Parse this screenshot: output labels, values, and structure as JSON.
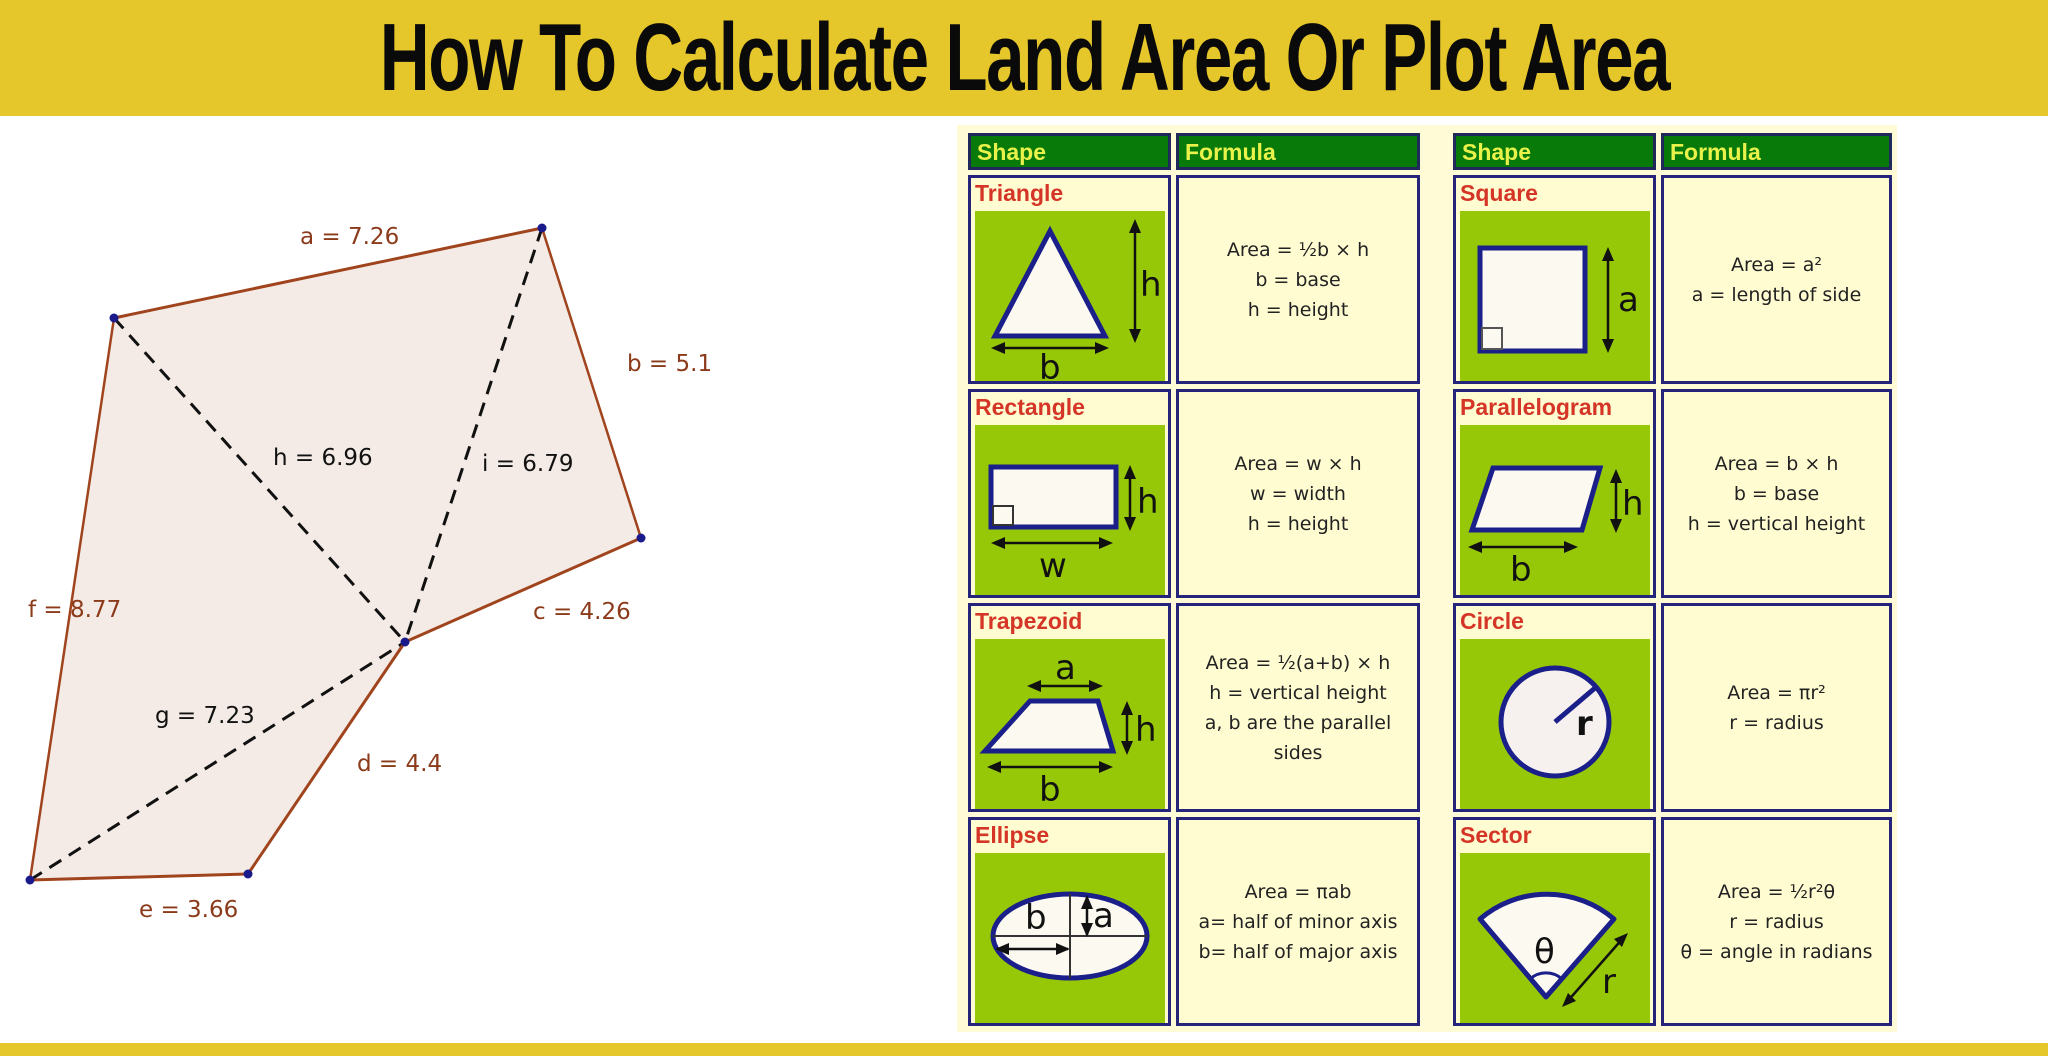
{
  "page": {
    "title": "How To Calculate Land Area Or Plot Area",
    "colors": {
      "banner": "#e5c62b",
      "title_text": "#0a0a0a",
      "polygon_edge": "#a0441e",
      "polygon_fill": "#f4ebe6",
      "vertex": "#1a1a8a",
      "table_header_bg": "#087a0a",
      "table_header_text": "#e9f24a",
      "cell_bg": "#fffcd2",
      "cell_border": "#24247a",
      "shape_name": "#d43526",
      "figure_bg": "#97c808",
      "figure_stroke": "#1a1f8a"
    }
  },
  "polygon": {
    "edges": [
      {
        "name": "a",
        "label": "a = 7.26",
        "length": 7.26
      },
      {
        "name": "b",
        "label": "b = 5.1",
        "length": 5.1
      },
      {
        "name": "c",
        "label": "c = 4.26",
        "length": 4.26
      },
      {
        "name": "d",
        "label": "d = 4.4",
        "length": 4.4
      },
      {
        "name": "e",
        "label": "e = 3.66",
        "length": 3.66
      },
      {
        "name": "f",
        "label": "f = 8.77",
        "length": 8.77
      }
    ],
    "diagonals": [
      {
        "name": "g",
        "label": "g = 7.23",
        "length": 7.23
      },
      {
        "name": "h",
        "label": "h = 6.96",
        "length": 6.96
      },
      {
        "name": "i",
        "label": "i = 6.79",
        "length": 6.79
      }
    ]
  },
  "tables": {
    "headers": {
      "shape": "Shape",
      "formula": "Formula"
    },
    "left": [
      {
        "shape": "Triangle",
        "icon": "triangle-icon",
        "figure_labels": {
          "base": "b",
          "height": "h"
        },
        "formula": [
          "Area = ½b × h",
          "b = base",
          "h = height"
        ]
      },
      {
        "shape": "Rectangle",
        "icon": "rectangle-icon",
        "figure_labels": {
          "width": "w",
          "height": "h"
        },
        "formula": [
          "Area = w × h",
          "w = width",
          "h = height"
        ]
      },
      {
        "shape": "Trapezoid",
        "icon": "trapezoid-icon",
        "figure_labels": {
          "top": "a",
          "bottom": "b",
          "height": "h"
        },
        "formula": [
          "Area = ½(a+b) × h",
          "h = vertical height",
          "a, b are the parallel",
          "sides"
        ]
      },
      {
        "shape": "Ellipse",
        "icon": "ellipse-icon",
        "figure_labels": {
          "major": "b",
          "minor": "a"
        },
        "formula": [
          "Area = πab",
          "a= half of minor axis",
          "b= half of major axis"
        ]
      }
    ],
    "right": [
      {
        "shape": "Square",
        "icon": "square-icon",
        "figure_labels": {
          "side": "a"
        },
        "formula": [
          "Area = a²",
          "a = length of side"
        ]
      },
      {
        "shape": "Parallelogram",
        "icon": "parallelogram-icon",
        "figure_labels": {
          "base": "b",
          "height": "h"
        },
        "formula": [
          "Area = b × h",
          "b = base",
          "h = vertical height"
        ]
      },
      {
        "shape": "Circle",
        "icon": "circle-icon",
        "figure_labels": {
          "radius": "r"
        },
        "formula": [
          "Area = πr²",
          "r = radius"
        ]
      },
      {
        "shape": "Sector",
        "icon": "sector-icon",
        "figure_labels": {
          "angle": "θ",
          "radius": "r"
        },
        "formula": [
          "Area = ½r²θ",
          "r = radius",
          "θ = angle in radians"
        ]
      }
    ]
  }
}
